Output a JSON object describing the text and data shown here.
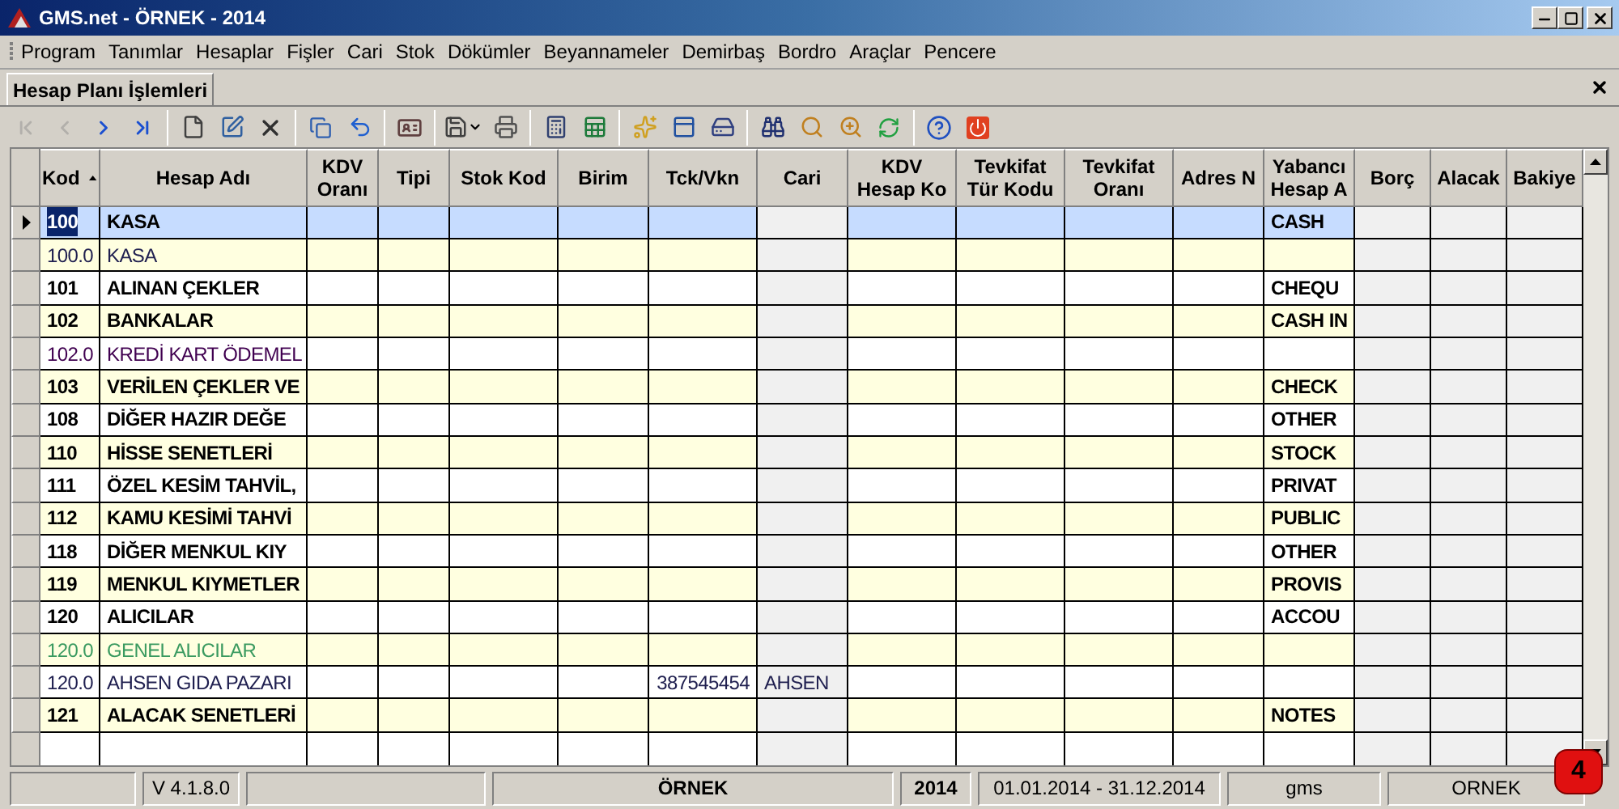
{
  "window": {
    "title": "GMS.net - ÖRNEK - 2014"
  },
  "menu": [
    "Program",
    "Tanımlar",
    "Hesaplar",
    "Fişler",
    "Cari",
    "Stok",
    "Dökümler",
    "Beyannameler",
    "Demirbaş",
    "Bordro",
    "Araçlar",
    "Pencere"
  ],
  "tabs": [
    {
      "label": "Hesap Planı İşlemleri",
      "selected": true
    }
  ],
  "toolbar_nav": [
    {
      "disabled": true
    },
    {
      "disabled": true
    },
    {
      "disabled": false
    },
    {
      "disabled": false
    }
  ],
  "table": {
    "columns": [
      {
        "label": "Kod",
        "sorted_ascending": true
      },
      {
        "label": "Hesap Adı"
      },
      {
        "label": "KDV Oranı"
      },
      {
        "label": "Tipi"
      },
      {
        "label": "Stok Kod"
      },
      {
        "label": "Birim"
      },
      {
        "label": "Tck/Vkn"
      },
      {
        "label": "Cari"
      },
      {
        "label": "KDV Hesap Ko"
      },
      {
        "label": "Tevkifat Tür Kodu"
      },
      {
        "label": "Tevkifat Oranı"
      },
      {
        "label": "Adres N"
      },
      {
        "label": "Yabancı Hesap A"
      },
      {
        "label": "Borç"
      },
      {
        "label": "Alacak"
      },
      {
        "label": "Bakiye"
      }
    ],
    "rows": [
      {
        "kod": "100",
        "name": "KASA",
        "bold": true,
        "selected": true,
        "color": "#000000",
        "yabanci": "CASH"
      },
      {
        "kod": "100.0",
        "name": "KASA",
        "bold": false,
        "selected": false,
        "color": "#202050"
      },
      {
        "kod": "101",
        "name": "ALINAN ÇEKLER",
        "bold": true,
        "selected": false,
        "color": "#000000",
        "yabanci": "CHEQU"
      },
      {
        "kod": "102",
        "name": "BANKALAR",
        "bold": true,
        "selected": false,
        "color": "#000000",
        "yabanci": "CASH IN"
      },
      {
        "kod": "102.0",
        "name": "KREDİ KART ÖDEMEL",
        "bold": false,
        "selected": false,
        "color": "#400050"
      },
      {
        "kod": "103",
        "name": "VERİLEN ÇEKLER VE",
        "bold": true,
        "selected": false,
        "color": "#000000",
        "yabanci": "CHECK"
      },
      {
        "kod": "108",
        "name": "DİĞER HAZIR DEĞE",
        "bold": true,
        "selected": false,
        "color": "#000000",
        "yabanci": "OTHER"
      },
      {
        "kod": "110",
        "name": "HİSSE SENETLERİ",
        "bold": true,
        "selected": false,
        "color": "#000000",
        "yabanci": "STOCK"
      },
      {
        "kod": "111",
        "name": "ÖZEL KESİM TAHVİL,",
        "bold": true,
        "selected": false,
        "color": "#000000",
        "yabanci": "PRIVAT"
      },
      {
        "kod": "112",
        "name": "KAMU KESİMİ TAHVİ",
        "bold": true,
        "selected": false,
        "color": "#000000",
        "yabanci": "PUBLIC"
      },
      {
        "kod": "118",
        "name": "DİĞER MENKUL KIY",
        "bold": true,
        "selected": false,
        "color": "#000000",
        "yabanci": "OTHER"
      },
      {
        "kod": "119",
        "name": "MENKUL KIYMETLER",
        "bold": true,
        "selected": false,
        "color": "#000000",
        "yabanci": "PROVIS"
      },
      {
        "kod": "120",
        "name": "ALICILAR",
        "bold": true,
        "selected": false,
        "color": "#000000",
        "yabanci": "ACCOU"
      },
      {
        "kod": "120.0",
        "name": "GENEL ALICILAR",
        "bold": false,
        "selected": false,
        "color": "#3a9a60"
      },
      {
        "kod": "120.0",
        "name": "AHSEN GIDA PAZARI",
        "bold": false,
        "selected": false,
        "color": "#202050",
        "tck_vkn": "387545454",
        "cari": "AHSEN"
      },
      {
        "kod": "121",
        "name": "ALACAK SENETLERİ",
        "bold": true,
        "selected": false,
        "color": "#000000",
        "yabanci": "NOTES"
      }
    ]
  },
  "status_bar": [
    {
      "text": "V 4.1.8.0",
      "bold": false
    },
    {
      "text": "ÖRNEK",
      "bold": true
    },
    {
      "text": "2014",
      "bold": true
    },
    {
      "text": "01.01.2014 - 31.12.2014",
      "bold": false
    },
    {
      "text": "gms",
      "bold": false
    },
    {
      "text": "ORNEK",
      "bold": false
    }
  ],
  "notification": {
    "count": "4"
  }
}
